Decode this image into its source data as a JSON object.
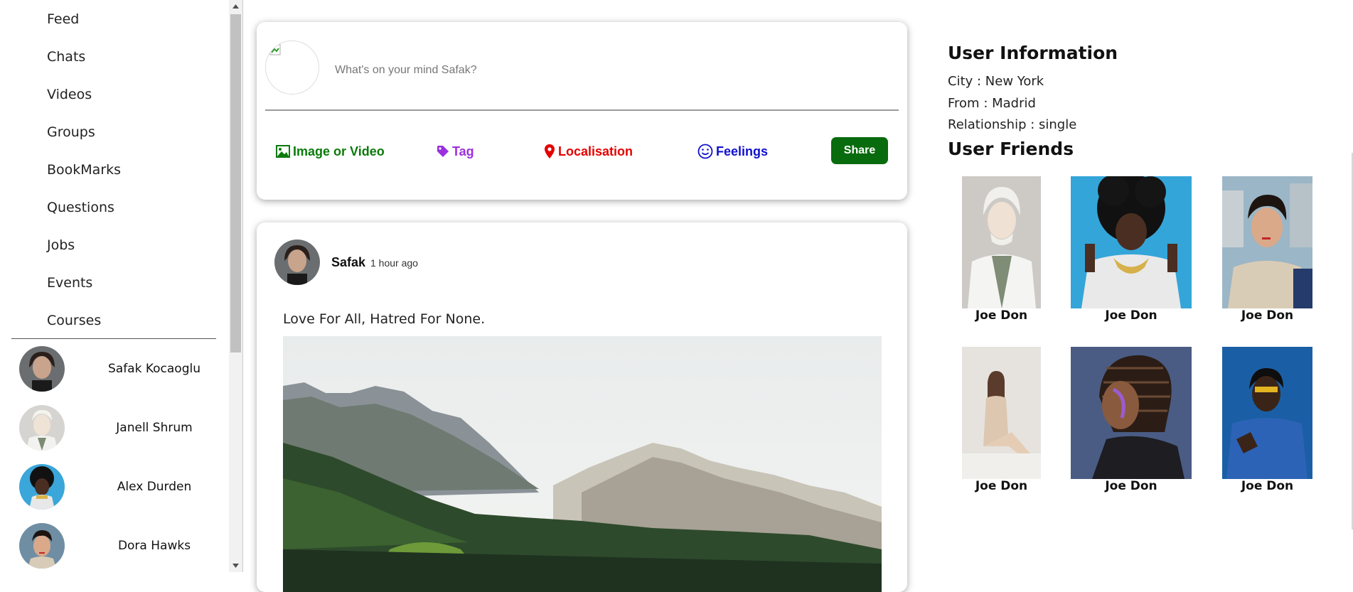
{
  "sidebar": {
    "menu": [
      {
        "label": "Feed",
        "name": "menu-item-feed"
      },
      {
        "label": "Chats",
        "name": "menu-item-chats"
      },
      {
        "label": "Videos",
        "name": "menu-item-videos"
      },
      {
        "label": "Groups",
        "name": "menu-item-groups"
      },
      {
        "label": "BookMarks",
        "name": "menu-item-bookmarks"
      },
      {
        "label": "Questions",
        "name": "menu-item-questions"
      },
      {
        "label": "Jobs",
        "name": "menu-item-jobs"
      },
      {
        "label": "Events",
        "name": "menu-item-events"
      },
      {
        "label": "Courses",
        "name": "menu-item-courses"
      }
    ],
    "friends": [
      {
        "name": "Safak Kocaoglu"
      },
      {
        "name": "Janell Shrum"
      },
      {
        "name": "Alex Durden"
      },
      {
        "name": "Dora Hawks"
      }
    ]
  },
  "composer": {
    "placeholder": "What's on your mind Safak?",
    "options": {
      "image": "Image or Video",
      "tag": "Tag",
      "location": "Localisation",
      "feelings": "Feelings"
    },
    "share_label": "Share",
    "colors": {
      "image": "#0b7a0b",
      "tag": "#9b30e0",
      "location": "#e60000",
      "feelings": "#1010d0",
      "share_bg": "#086b0d"
    }
  },
  "post": {
    "author": "Safak",
    "time": "1 hour ago",
    "caption": "Love For All, Hatred For None."
  },
  "right": {
    "info_title": "User Information",
    "info": [
      "City : New York",
      "From : Madrid",
      "Relationship : single"
    ],
    "friends_title": "User Friends",
    "friends": [
      {
        "name": "Joe Don"
      },
      {
        "name": "Joe Don"
      },
      {
        "name": "Joe Don"
      },
      {
        "name": "Joe Don"
      },
      {
        "name": "Joe Don"
      },
      {
        "name": "Joe Don"
      }
    ]
  }
}
